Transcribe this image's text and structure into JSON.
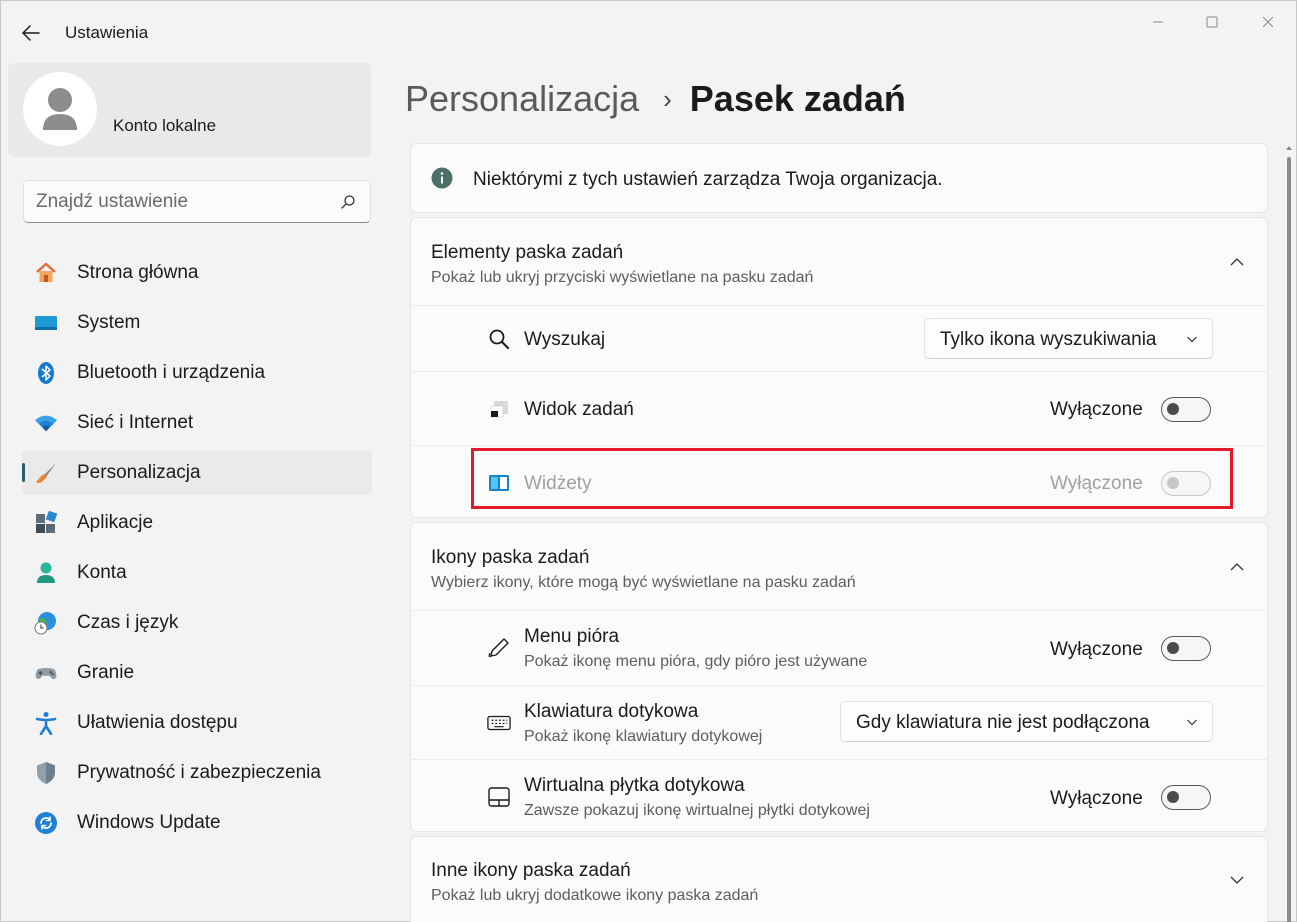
{
  "window": {
    "title": "Ustawienia"
  },
  "profile": {
    "name": "Konto lokalne"
  },
  "search": {
    "placeholder": "Znajdź ustawienie"
  },
  "sidebar": {
    "items": [
      {
        "label": "Strona główna",
        "icon": "home-icon"
      },
      {
        "label": "System",
        "icon": "system-icon"
      },
      {
        "label": "Bluetooth i urządzenia",
        "icon": "bluetooth-icon"
      },
      {
        "label": "Sieć i Internet",
        "icon": "wifi-icon"
      },
      {
        "label": "Personalizacja",
        "icon": "brush-icon",
        "active": true
      },
      {
        "label": "Aplikacje",
        "icon": "apps-icon"
      },
      {
        "label": "Konta",
        "icon": "person-icon"
      },
      {
        "label": "Czas i język",
        "icon": "globe-clock-icon"
      },
      {
        "label": "Granie",
        "icon": "gamepad-icon"
      },
      {
        "label": "Ułatwienia dostępu",
        "icon": "accessibility-icon"
      },
      {
        "label": "Prywatność i zabezpieczenia",
        "icon": "shield-icon"
      },
      {
        "label": "Windows Update",
        "icon": "update-icon"
      }
    ]
  },
  "breadcrumb": {
    "parent": "Personalizacja",
    "separator": "›",
    "current": "Pasek zadań"
  },
  "info": {
    "text": "Niektórymi z tych ustawień zarządza Twoja organizacja."
  },
  "sections": {
    "taskbar_items": {
      "title": "Elementy paska zadań",
      "subtitle": "Pokaż lub ukryj przyciski wyświetlane na pasku zadań",
      "search": {
        "label": "Wyszukaj",
        "value": "Tylko ikona wyszukiwania"
      },
      "task_view": {
        "label": "Widok zadań",
        "state": "Wyłączone"
      },
      "widgets": {
        "label": "Widżety",
        "state": "Wyłączone",
        "disabled": true
      }
    },
    "taskbar_icons": {
      "title": "Ikony paska zadań",
      "subtitle": "Wybierz ikony, które mogą być wyświetlane na pasku zadań",
      "pen_menu": {
        "label": "Menu pióra",
        "sub": "Pokaż ikonę menu pióra, gdy pióro jest używane",
        "state": "Wyłączone"
      },
      "touch_keyboard": {
        "label": "Klawiatura dotykowa",
        "sub": "Pokaż ikonę klawiatury dotykowej",
        "value": "Gdy klawiatura nie jest podłączona"
      },
      "virtual_touchpad": {
        "label": "Wirtualna płytka dotykowa",
        "sub": "Zawsze pokazuj ikonę wirtualnej płytki dotykowej",
        "state": "Wyłączone"
      }
    },
    "other_icons": {
      "title": "Inne ikony paska zadań",
      "subtitle": "Pokaż lub ukryj dodatkowe ikony paska zadań"
    }
  },
  "colors": {
    "accent": "#2f5f6a",
    "highlight": "#e11b2a",
    "background": "#f3f3f3",
    "card": "#fbfbfb"
  }
}
